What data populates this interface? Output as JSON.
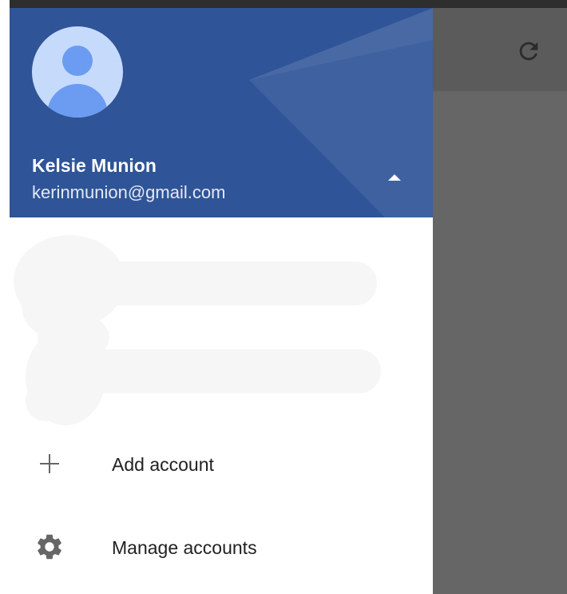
{
  "account": {
    "name": "Kelsie Munion",
    "email": "kerinmunion@gmail.com"
  },
  "icons": {
    "avatar": "default-avatar-icon",
    "collapse": "caret-up-icon",
    "refresh": "refresh-icon",
    "add": "plus-icon",
    "manage": "gear-icon"
  },
  "menu": {
    "add_account_label": "Add account",
    "manage_accounts_label": "Manage accounts"
  },
  "colors": {
    "header": "#2f5497",
    "scrim": "#666666",
    "avatar_bg": "#c6dafc",
    "avatar_fg": "#6b9cf2"
  }
}
